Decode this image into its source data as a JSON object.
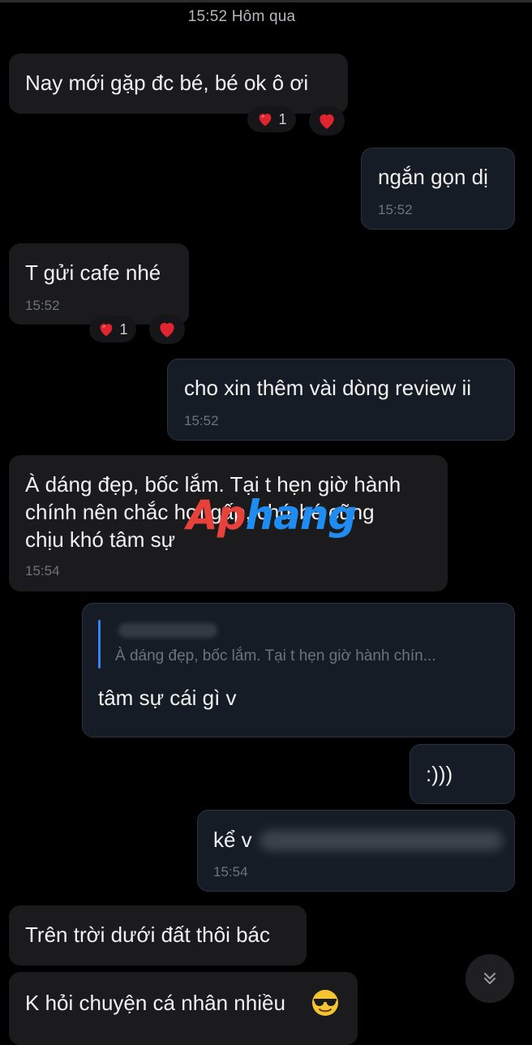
{
  "header": {
    "day_stamp": "15:52 Hôm qua"
  },
  "messages": [
    {
      "text": "Nay mới gặp đc bé, bé ok ô ơi",
      "reaction_count": "1"
    },
    {
      "text": "ngắn gọn dị",
      "time": "15:52"
    },
    {
      "text": "T gửi cafe nhé",
      "time": "15:52",
      "reaction_count": "1"
    },
    {
      "text": "cho xin thêm vài dòng review ii",
      "time": "15:52"
    },
    {
      "line1": "À dáng đẹp, bốc lắm. Tại t hẹn giờ hành",
      "line2": "chính nên chắc hơi gấp, chứ bé cũng",
      "line3": "chịu khó tâm sự",
      "time": "15:54"
    },
    {
      "quote": "À dáng đẹp, bốc lắm. Tại t hẹn giờ hành chín...",
      "text": "tâm sự cái gì v"
    },
    {
      "text": ":)))"
    },
    {
      "text": "kể v",
      "time": "15:54"
    },
    {
      "text": "Trên trời dưới đất thôi bác"
    },
    {
      "text": "K hỏi chuyện cá nhân nhiều"
    }
  ],
  "watermark": {
    "part1": "Ap",
    "part2": "hang"
  },
  "icons": {
    "reaction": "heart-icon",
    "scroll": "chevron-double-down-icon",
    "emoji": "sunglasses-emoji-icon"
  },
  "colors": {
    "heart": "#e0252f",
    "reply_bar": "#3d7ff2",
    "background": "#000000"
  }
}
